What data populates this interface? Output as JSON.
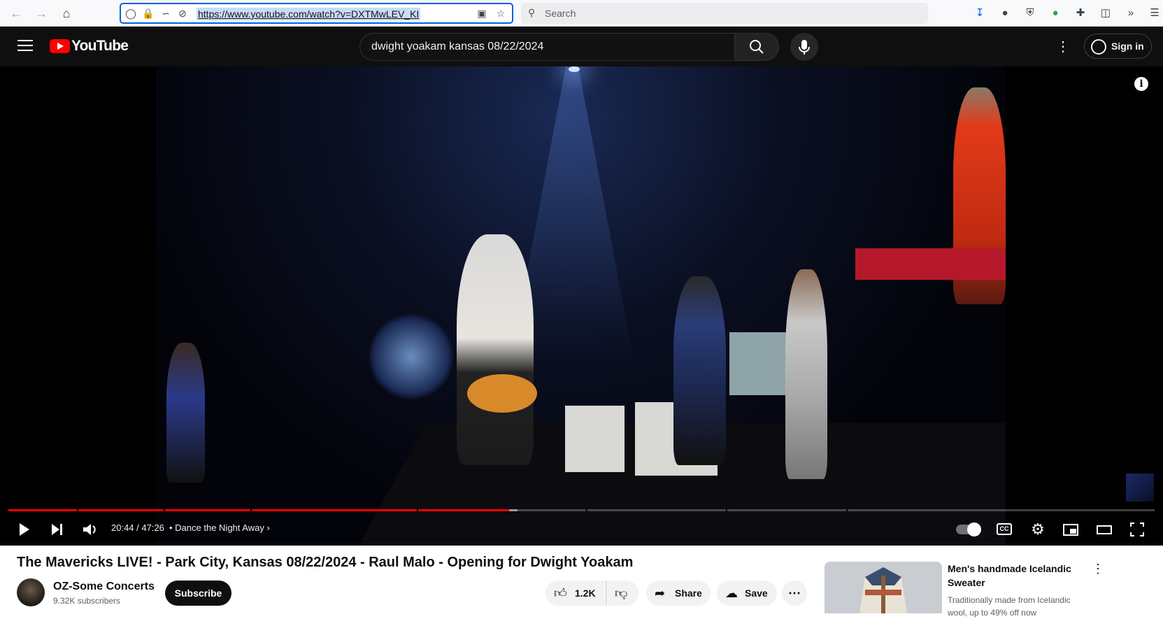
{
  "browser": {
    "url": "https://www.youtube.com/watch?v=DXTMwLEV_KI",
    "search_placeholder": "Search"
  },
  "header": {
    "logo_text": "YouTube",
    "search_query": "dwight yoakam kansas 08/22/2024",
    "sign_in_label": "Sign in"
  },
  "player": {
    "current_time": "20:44",
    "duration": "47:26",
    "time_display": "20:44 / 47:26",
    "chapter_title": "Dance the Night Away",
    "played_fraction": 0.437,
    "loaded_fraction": 0.444,
    "cc_label": "CC"
  },
  "video": {
    "title": "The Mavericks LIVE! - Park City, Kansas 08/22/2024 - Raul Malo - Opening for Dwight Yoakam"
  },
  "channel": {
    "name": "OZ-Some Concerts",
    "subscribers": "9.32K subscribers",
    "subscribe_label": "Subscribe"
  },
  "actions": {
    "like_count": "1.2K",
    "share_label": "Share",
    "save_label": "Save"
  },
  "ad": {
    "title": "Men's handmade Icelandic Sweater",
    "description": "Traditionally made from Icelandic wool, up to 49% off now"
  },
  "colors": {
    "accent_red": "#ff0000",
    "header_bg": "#0f0f0f",
    "url_focus": "#0061e0"
  }
}
